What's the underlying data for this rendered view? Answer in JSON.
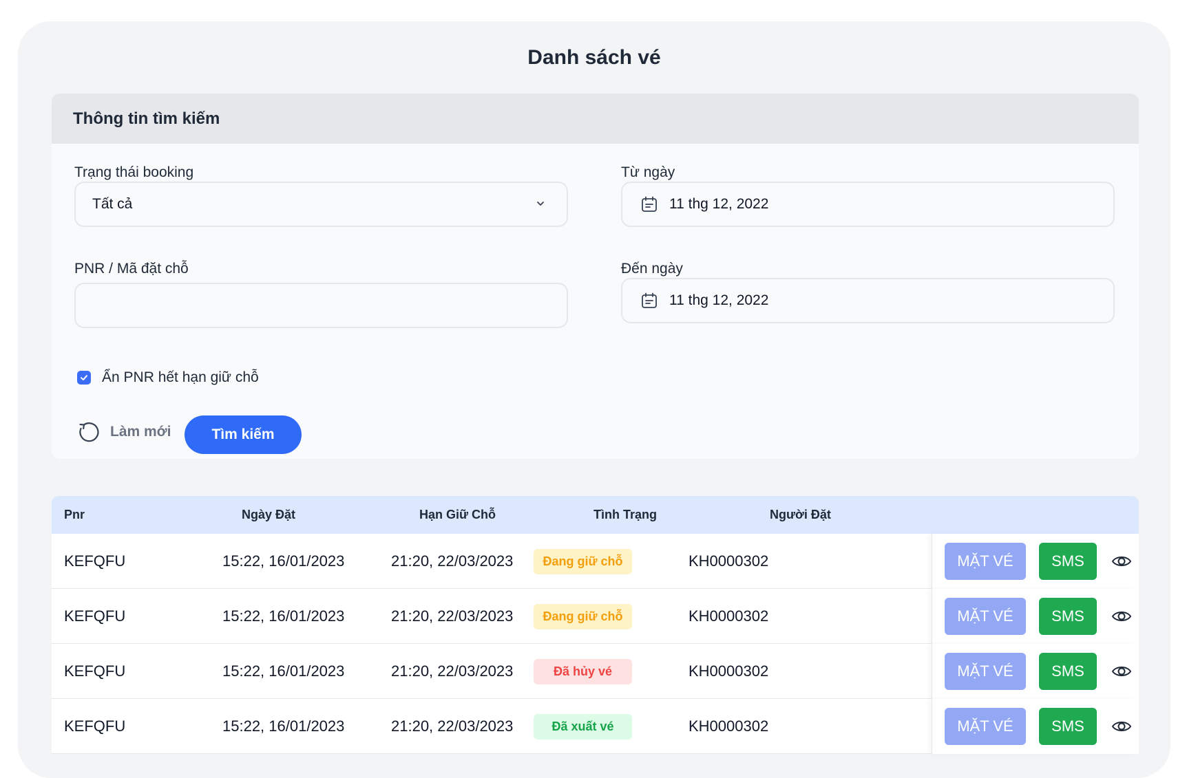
{
  "page": {
    "title": "Danh sách vé"
  },
  "search": {
    "header": "Thông tin tìm kiếm",
    "status_label": "Trạng thái booking",
    "status_value": "Tất cả",
    "from_label": "Từ ngày",
    "from_value": "11 thg 12, 2022",
    "pnr_label": "PNR / Mã đặt chỗ",
    "pnr_value": "",
    "to_label": "Đến ngày",
    "to_value": "11 thg 12, 2022",
    "hide_expired_label": "Ẩn PNR hết hạn giữ chỗ",
    "hide_expired_checked": true,
    "reset_label": "Làm mới",
    "search_label": "Tìm kiếm"
  },
  "table": {
    "columns": [
      "Pnr",
      "Ngày Đặt",
      "Hạn Giữ Chỗ",
      "Tình Trạng",
      "Người Đặt"
    ],
    "rows": [
      {
        "pnr": "KEFQFU",
        "booked": "15:22, 16/01/2023",
        "hold": "21:20, 22/03/2023",
        "status": "Đang giữ chỗ",
        "status_type": "holding",
        "booker": "KH0000302"
      },
      {
        "pnr": "KEFQFU",
        "booked": "15:22, 16/01/2023",
        "hold": "21:20, 22/03/2023",
        "status": "Đang giữ chỗ",
        "status_type": "holding",
        "booker": "KH0000302"
      },
      {
        "pnr": "KEFQFU",
        "booked": "15:22, 16/01/2023",
        "hold": "21:20, 22/03/2023",
        "status": "Đã hủy vé",
        "status_type": "cancelled",
        "booker": "KH0000302"
      },
      {
        "pnr": "KEFQFU",
        "booked": "15:22, 16/01/2023",
        "hold": "21:20, 22/03/2023",
        "status": "Đã xuất vé",
        "status_type": "issued",
        "booker": "KH0000302"
      }
    ],
    "action_mat_label": "MẶT VÉ",
    "action_sms_label": "SMS",
    "action_view_icon": "eye-icon"
  },
  "colors": {
    "primary": "#2f6bf6",
    "mat_button": "#93a8f4",
    "sms_button": "#1faa52",
    "holding_bg": "#fef3c7",
    "holding_text": "#f59e0b",
    "cancelled_bg": "#fee2e2",
    "cancelled_text": "#ef4444",
    "issued_bg": "#dcfce7",
    "issued_text": "#16a34a"
  }
}
